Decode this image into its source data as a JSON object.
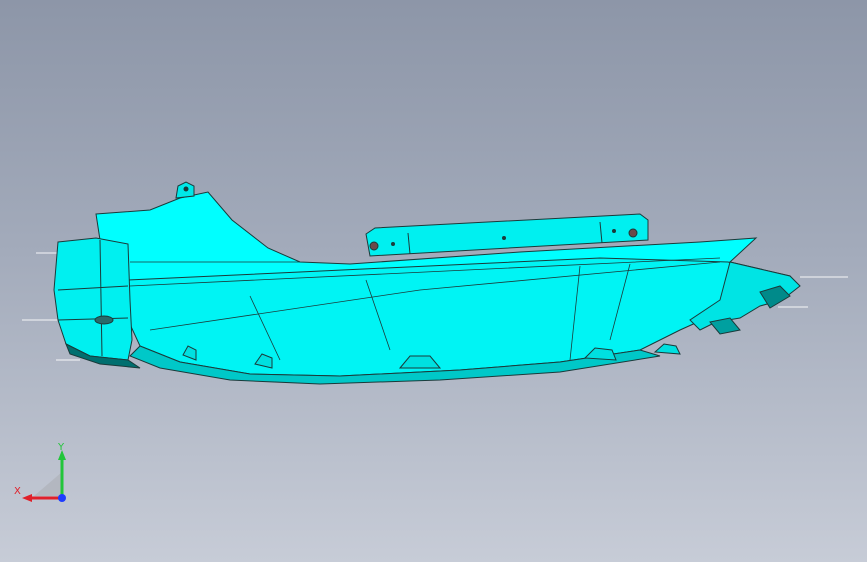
{
  "viewport": {
    "background_top": "#8d96a8",
    "background_bottom": "#c7ccd7"
  },
  "model": {
    "body_color": "#00ffff",
    "shade_color": "#00b8b8",
    "dark_color": "#007a7a",
    "edge_color": "#1a3a3a"
  },
  "triad": {
    "x_label": "X",
    "y_label": "Y",
    "x_color": "#e0202a",
    "y_color": "#22c53a",
    "z_color": "#1e3cff"
  }
}
